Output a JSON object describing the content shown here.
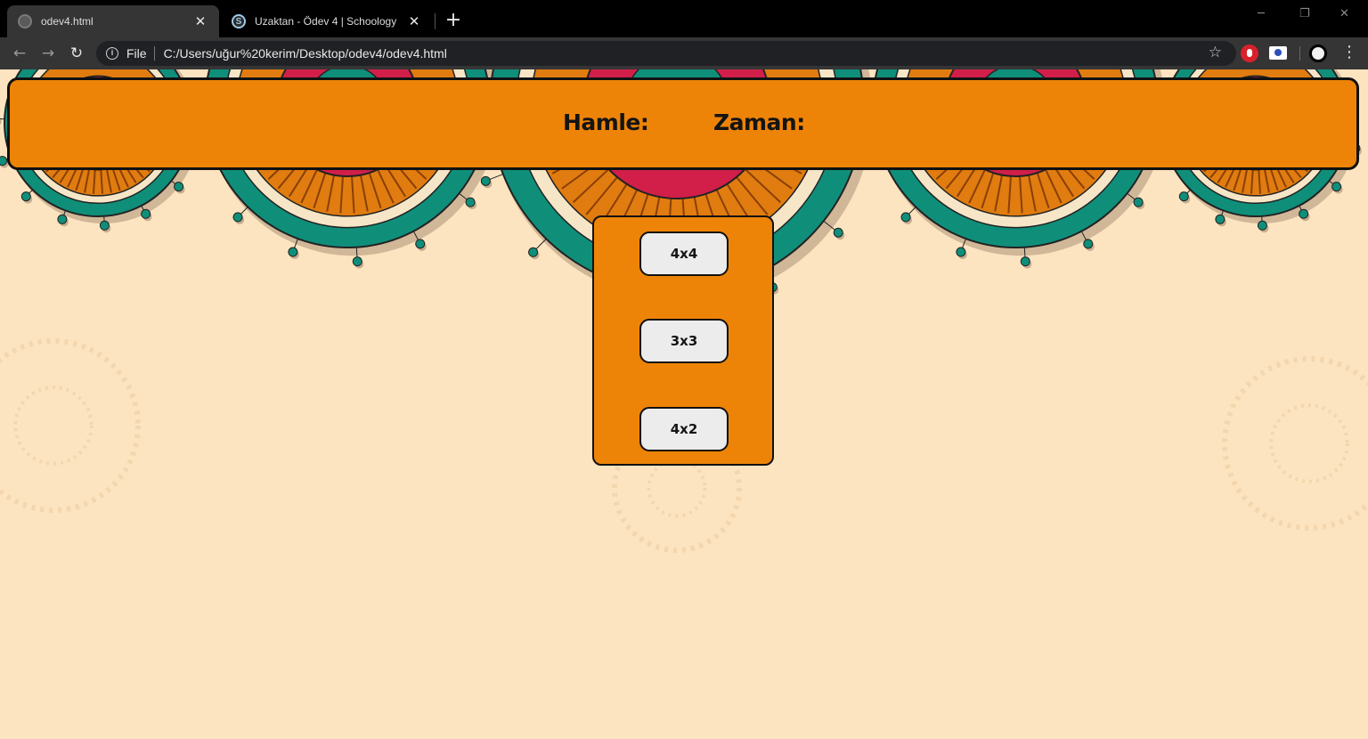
{
  "browser": {
    "tabs": [
      {
        "title": "odev4.html",
        "favicon": "globe-icon",
        "active": true
      },
      {
        "title": "Uzaktan - Ödev 4 | Schoology",
        "favicon": "schoology-icon",
        "active": false
      }
    ],
    "new_tab_symbol": "+",
    "close_symbol": "✕",
    "address": {
      "scheme_label": "File",
      "url": "C:/Users/uğur%20kerim/Desktop/odev4/odev4.html"
    }
  },
  "game": {
    "moves_label": "Hamle:",
    "time_label": "Zaman:",
    "size_options": [
      "4x4",
      "3x3",
      "4x2"
    ]
  },
  "colors": {
    "panel_orange": "#ee8407",
    "page_background": "#fde4c0",
    "mandala_teal": "#0f8f7a",
    "mandala_red": "#d11f4a",
    "button_gray": "#ececec"
  }
}
